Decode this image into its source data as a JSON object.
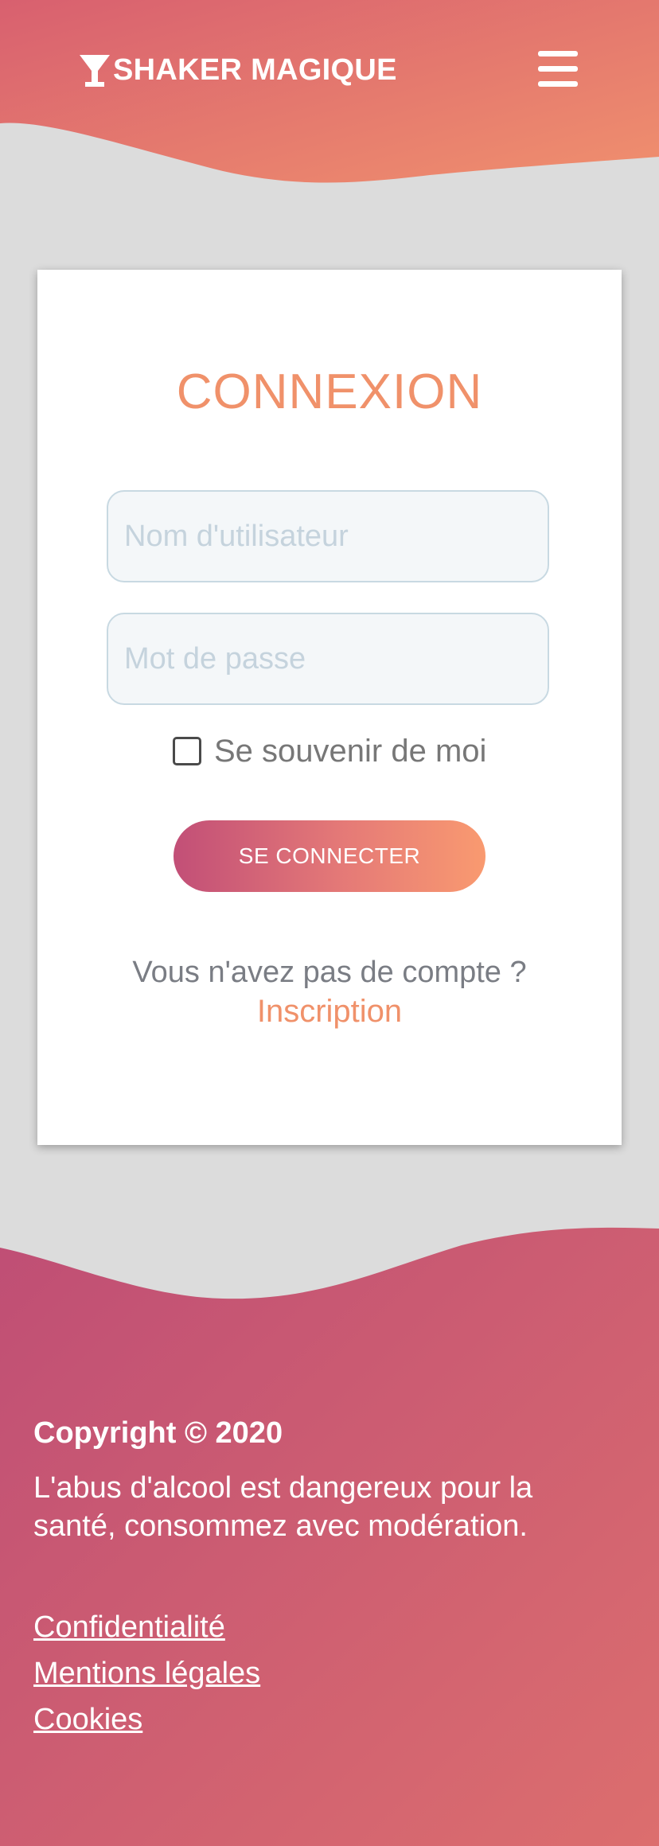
{
  "header": {
    "brand_name": "SHAKER MAGIQUE",
    "logo_icon": "cocktail-glass-icon",
    "menu_icon": "hamburger-menu-icon",
    "gradient": [
      "#d8606f",
      "#f0906e"
    ]
  },
  "login": {
    "title": "CONNEXION",
    "username_placeholder": "Nom d'utilisateur",
    "password_placeholder": "Mot de passe",
    "remember_label": "Se souvenir de moi",
    "remember_checked": false,
    "submit_label": "SE CONNECTER",
    "no_account_text": "Vous n'avez pas de compte ?",
    "signup_link": "Inscription",
    "accent": "#f0916a"
  },
  "footer": {
    "copyright": "Copyright © 2020",
    "warning": "L'abus d'alcool est dangereux pour la santé, consommez avec modération.",
    "links": [
      "Confidentialité",
      "Mentions légales",
      "Cookies"
    ],
    "gradient": [
      "#bf4e75",
      "#dc6e6e"
    ]
  }
}
